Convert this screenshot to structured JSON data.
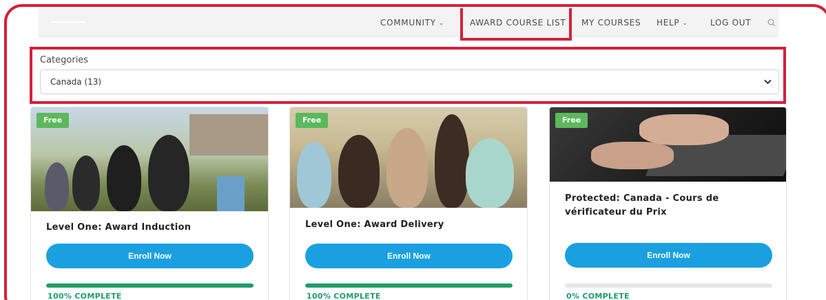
{
  "nav": {
    "items": [
      {
        "label": "COMMUNITY",
        "has_dropdown": true
      },
      {
        "label": "AWARD COURSE LIST",
        "has_dropdown": false
      },
      {
        "label": "MY COURSES",
        "has_dropdown": false
      },
      {
        "label": "HELP",
        "has_dropdown": true
      },
      {
        "label": "LOG OUT",
        "has_dropdown": false
      }
    ],
    "search_icon": "search-icon"
  },
  "categories": {
    "label": "Categories",
    "selected": "Canada (13)"
  },
  "courses": [
    {
      "badge": "Free",
      "title": "Level One: Award Induction",
      "button": "Enroll Now",
      "progress": 100,
      "progress_label": "100% COMPLETE"
    },
    {
      "badge": "Free",
      "title": "Level One: Award Delivery",
      "button": "Enroll Now",
      "progress": 100,
      "progress_label": "100% COMPLETE"
    },
    {
      "badge": "Free",
      "title": "Protected: Canada - Cours de vérificateur du Prix",
      "button": "Enroll Now",
      "progress": 0,
      "progress_label": "0% COMPLETE"
    }
  ],
  "colors": {
    "highlight": "#d3203a",
    "enroll_button": "#1aa0e1",
    "progress": "#1e9c6b",
    "badge": "#5cb85c"
  }
}
